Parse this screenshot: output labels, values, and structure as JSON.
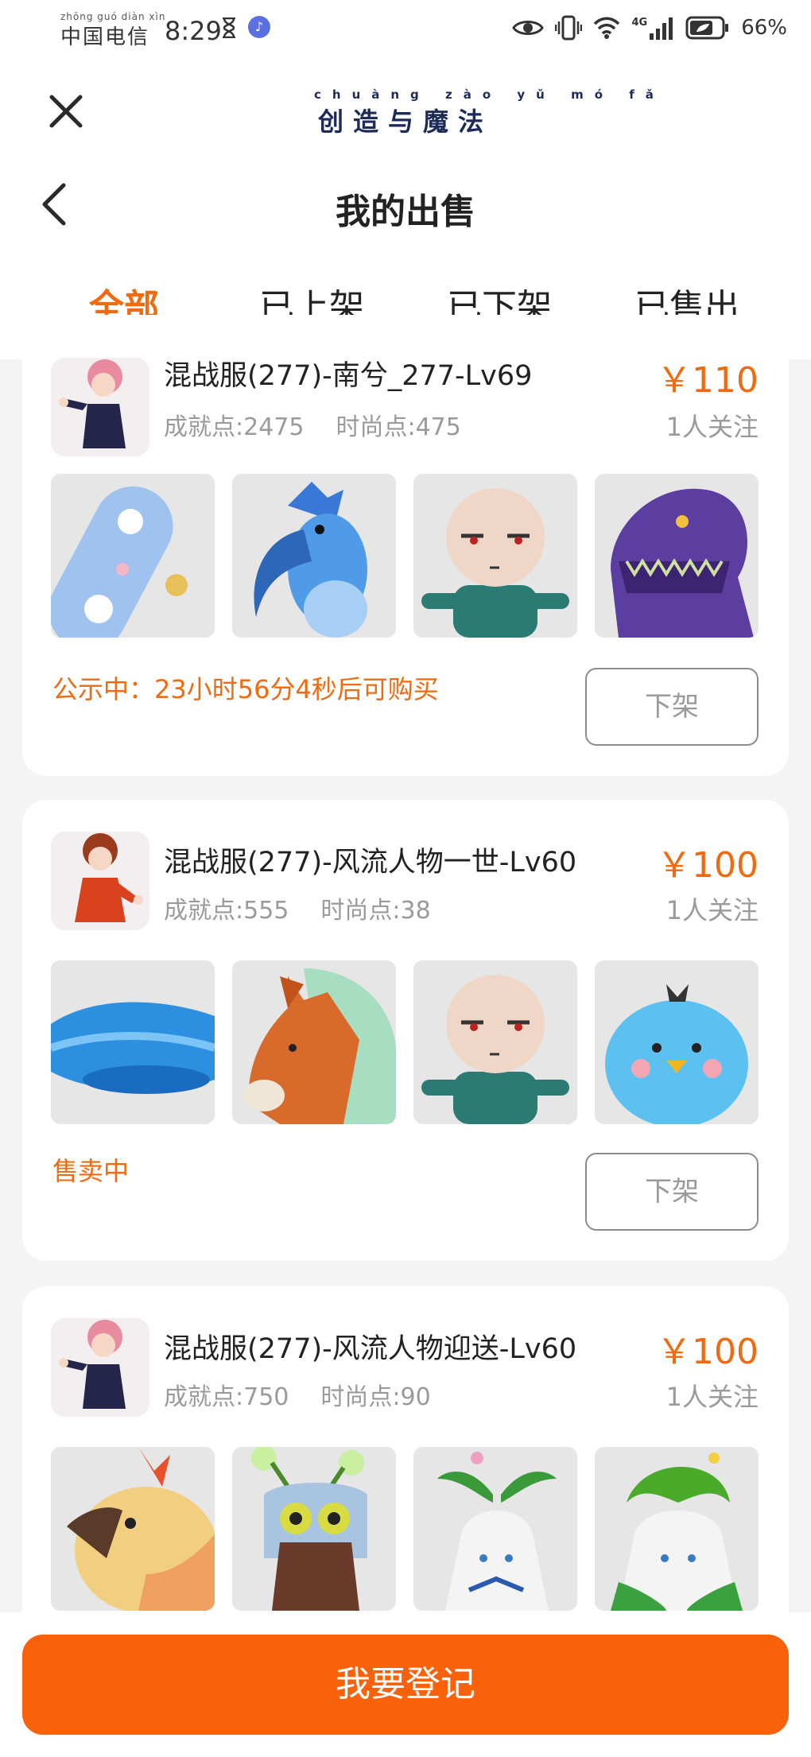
{
  "status_bar": {
    "carrier_pinyin": "zhōng guó diàn xìn",
    "carrier": "中国电信",
    "time": "8:29",
    "network": "4G",
    "battery": "66%"
  },
  "header": {
    "logo_pinyin": "chuàng zào yǔ mó fǎ",
    "logo_title": "创造与魔法",
    "page_title": "我的出售"
  },
  "tabs": [
    {
      "label": "全部",
      "active": true
    },
    {
      "label": "已上架",
      "active": false
    },
    {
      "label": "已下架",
      "active": false
    },
    {
      "label": "已售出",
      "active": false
    }
  ],
  "listings": [
    {
      "title": "混战服(277)-南兮_277-Lv69",
      "price": "￥110",
      "achievement": "成就点:2475",
      "fashion": "时尚点:475",
      "followers": "1人关注",
      "status": "公示中：23小时56分4秒后可购买",
      "button": "下架",
      "thumbs": [
        "skateboard",
        "blue-bird",
        "bald-character",
        "purple-dinosaur"
      ]
    },
    {
      "title": "混战服(277)-风流人物一世-Lv60",
      "price": "￥100",
      "achievement": "成就点:555",
      "fashion": "时尚点:38",
      "followers": "1人关注",
      "status": "售卖中",
      "button": "下架",
      "thumbs": [
        "blue-whale",
        "orange-horse",
        "bald-character",
        "blue-chick"
      ]
    },
    {
      "title": "混战服(277)-风流人物迎送-Lv60",
      "price": "￥100",
      "achievement": "成就点:750",
      "fashion": "时尚点:90",
      "followers": "1人关注",
      "thumbs": [
        "phoenix",
        "antler-creature",
        "sprout-spirit",
        "leaf-spirit"
      ]
    }
  ],
  "bottom": {
    "register_label": "我要登记"
  },
  "colors": {
    "accent": "#ef6a10",
    "button": "#f9620a"
  }
}
